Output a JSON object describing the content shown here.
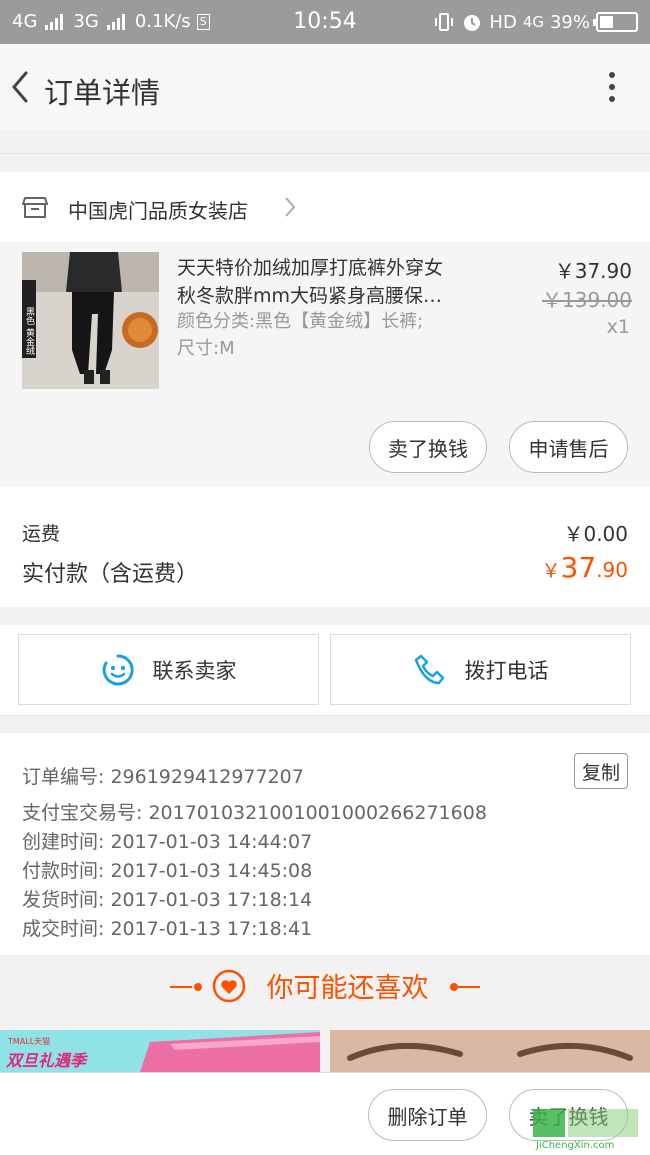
{
  "status_bar": {
    "network1": "4G",
    "network2": "3G",
    "speed": "0.1K/s",
    "s_badge": "S",
    "time": "10:54",
    "hd": "HD",
    "network3": "4G",
    "battery": "39%",
    "battery_level": 0.39
  },
  "nav": {
    "title": "订单详情"
  },
  "shop": {
    "name": "中国虎门品质女装店"
  },
  "product": {
    "title_line1": "天天特价加绒加厚打底裤外穿女",
    "title_line2": "秋冬款胖mm大码紧身高腰保…",
    "attr_line1": "颜色分类:黑色【黄金绒】长裤;",
    "attr_line2": "尺寸:M",
    "price": "￥37.90",
    "original_price": "￥139.00",
    "quantity": "x1",
    "thumb_text": "黑色 黄金绒",
    "buttons": {
      "sell": "卖了换钱",
      "after_sale": "申请售后"
    }
  },
  "fees": {
    "shipping_label": "运费",
    "shipping_value": "￥0.00",
    "paid_label": "实付款（含运费）",
    "paid_currency": "￥",
    "paid_int": "37",
    "paid_dec": ".90"
  },
  "contact": {
    "seller": "联系卖家",
    "call": "拨打电话"
  },
  "order": {
    "number": "订单编号: 2961929412977207",
    "copy": "复制",
    "alipay": "支付宝交易号: 2017010321001001000266271608",
    "created": "创建时间: 2017-01-03 14:44:07",
    "paid": "付款时间: 2017-01-03 14:45:08",
    "shipped": "发货时间: 2017-01-03 17:18:14",
    "completed": "成交时间: 2017-01-13 17:18:41"
  },
  "recommend": {
    "title": "你可能还喜欢",
    "left_brand": "TMALL天猫",
    "left_promo": "双旦礼遇季"
  },
  "bottom": {
    "delete": "删除订单",
    "sell": "卖了换钱"
  },
  "watermark": {
    "text": "JiChengXin.com"
  },
  "colors": {
    "accent": "#ff5000",
    "status_bar": "#9b9b9b",
    "icon_blue": "#1ea0e0"
  }
}
